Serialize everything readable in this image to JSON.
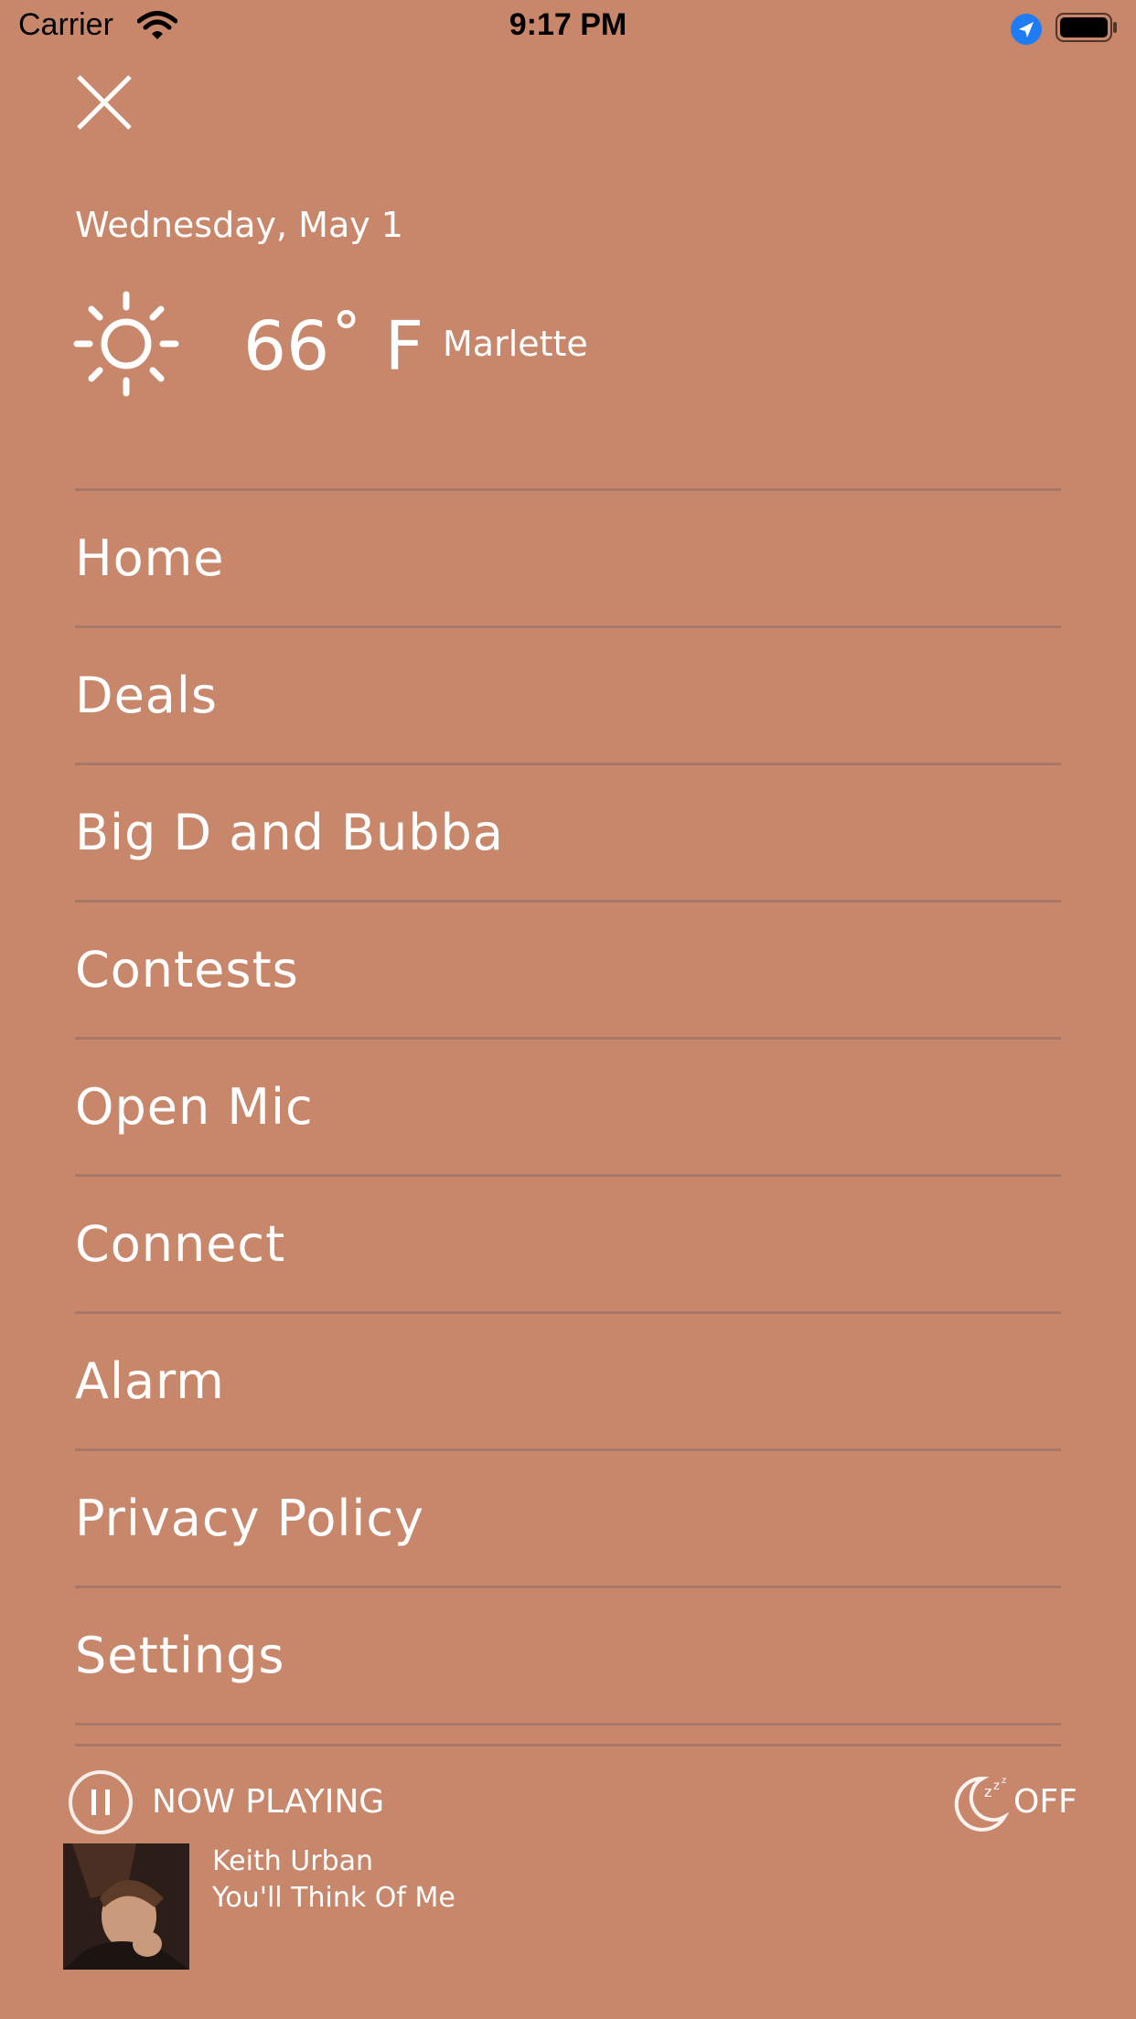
{
  "status_bar": {
    "carrier": "Carrier",
    "time": "9:17 PM"
  },
  "header": {
    "date": "Wednesday, May 1",
    "weather": {
      "temperature": "66˚ F",
      "location": "Marlette",
      "icon": "sun-icon"
    }
  },
  "menu": {
    "items": [
      {
        "label": "Home"
      },
      {
        "label": "Deals"
      },
      {
        "label": "Big D and Bubba"
      },
      {
        "label": "Contests"
      },
      {
        "label": "Open Mic"
      },
      {
        "label": "Connect"
      },
      {
        "label": "Alarm"
      },
      {
        "label": "Privacy Policy"
      },
      {
        "label": "Settings"
      }
    ]
  },
  "player": {
    "status_label": "NOW PLAYING",
    "sleep_timer_label": "OFF",
    "artist": "Keith Urban",
    "song": "You'll Think Of Me"
  },
  "colors": {
    "background": "#c8866a",
    "text": "#ffffff",
    "location_blue": "#1f7cf5"
  }
}
